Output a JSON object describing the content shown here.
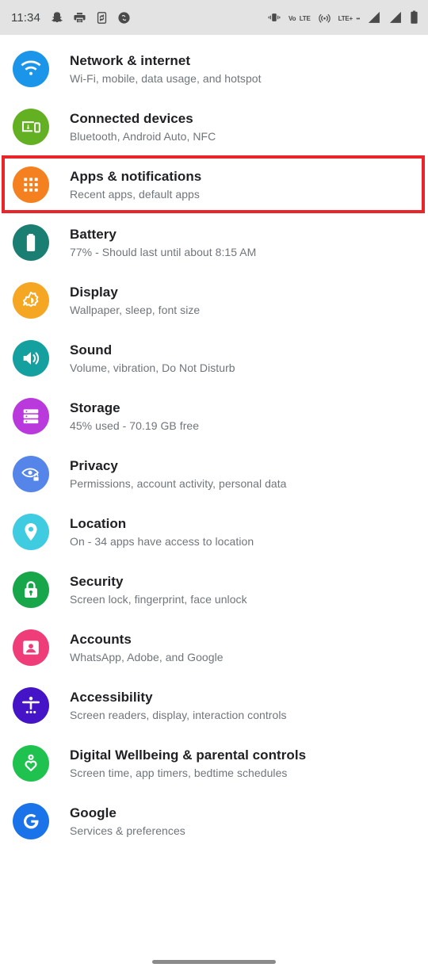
{
  "status_bar": {
    "time": "11:34",
    "left_icons": [
      {
        "name": "snapchat-icon"
      },
      {
        "name": "printer-icon"
      },
      {
        "name": "phone-sync-icon"
      },
      {
        "name": "shazam-icon"
      }
    ],
    "right_icons": [
      {
        "name": "vibrate-icon"
      },
      {
        "name": "volte-icon",
        "line1": "Vo",
        "line2": "LTE"
      },
      {
        "name": "hotspot-icon"
      },
      {
        "name": "lte-plus-icon",
        "line1": "LTE+",
        "line2": "••"
      },
      {
        "name": "signal-bars-sim1-icon"
      },
      {
        "name": "signal-bars-sim2-icon"
      },
      {
        "name": "battery-icon"
      }
    ]
  },
  "highlight": {
    "color": "#e8252a",
    "target": "apps-and-notifications"
  },
  "nav_bar": {
    "gesture_pill": "home-gesture-pill"
  },
  "settings": {
    "items": [
      {
        "key": "network-internet",
        "title": "Network & internet",
        "subtitle": "Wi-Fi, mobile, data usage, and hotspot",
        "icon": "wifi-icon",
        "icon_color": "#1a95e9"
      },
      {
        "key": "connected-devices",
        "title": "Connected devices",
        "subtitle": "Bluetooth, Android Auto, NFC",
        "icon": "connected-devices-icon",
        "icon_color": "#63b122"
      },
      {
        "key": "apps-and-notifications",
        "title": "Apps & notifications",
        "subtitle": "Recent apps, default apps",
        "icon": "app-grid-icon",
        "icon_color": "#f4801f",
        "highlighted": true
      },
      {
        "key": "battery",
        "title": "Battery",
        "subtitle": "77% - Should last until about 8:15 AM",
        "icon": "battery-full-icon",
        "icon_color": "#1a7f72"
      },
      {
        "key": "display",
        "title": "Display",
        "subtitle": "Wallpaper, sleep, font size",
        "icon": "brightness-icon",
        "icon_color": "#f5a623"
      },
      {
        "key": "sound",
        "title": "Sound",
        "subtitle": "Volume, vibration, Do Not Disturb",
        "icon": "speaker-icon",
        "icon_color": "#15a0a0"
      },
      {
        "key": "storage",
        "title": "Storage",
        "subtitle": "45% used - 70.19 GB free",
        "icon": "storage-racks-icon",
        "icon_color": "#b939dd"
      },
      {
        "key": "privacy",
        "title": "Privacy",
        "subtitle": "Permissions, account activity, personal data",
        "icon": "eye-lock-icon",
        "icon_color": "#5585e8"
      },
      {
        "key": "location",
        "title": "Location",
        "subtitle": "On - 34 apps have access to location",
        "icon": "map-pin-icon",
        "icon_color": "#3fcbe0"
      },
      {
        "key": "security",
        "title": "Security",
        "subtitle": "Screen lock, fingerprint, face unlock",
        "icon": "padlock-icon",
        "icon_color": "#17a64a"
      },
      {
        "key": "accounts",
        "title": "Accounts",
        "subtitle": "WhatsApp, Adobe, and Google",
        "icon": "account-card-icon",
        "icon_color": "#ee3d78"
      },
      {
        "key": "accessibility",
        "title": "Accessibility",
        "subtitle": "Screen readers, display, interaction controls",
        "icon": "accessibility-person-icon",
        "icon_color": "#4514c7"
      },
      {
        "key": "digital-wellbeing",
        "title": "Digital Wellbeing & parental controls",
        "subtitle": "Screen time, app timers, bedtime schedules",
        "icon": "wellbeing-heart-icon",
        "icon_color": "#1fc24f"
      },
      {
        "key": "google",
        "title": "Google",
        "subtitle": "Services & preferences",
        "icon": "google-g-icon",
        "icon_color": "#1a73e8"
      }
    ]
  }
}
